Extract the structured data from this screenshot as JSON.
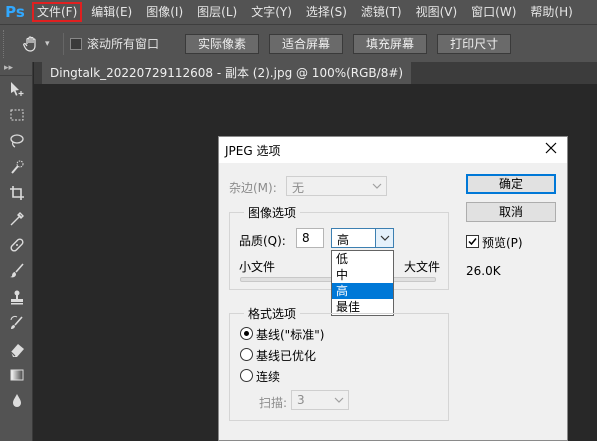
{
  "app": {
    "logo": "Ps",
    "menu": [
      "文件(F)",
      "编辑(E)",
      "图像(I)",
      "图层(L)",
      "文字(Y)",
      "选择(S)",
      "滤镜(T)",
      "视图(V)",
      "窗口(W)",
      "帮助(H)"
    ],
    "highlighted_menu": "文件(F)"
  },
  "options_bar": {
    "scroll_all_label": "滚动所有窗口",
    "buttons": [
      "实际像素",
      "适合屏幕",
      "填充屏幕",
      "打印尺寸"
    ]
  },
  "toolbar": {
    "header": "▸▸",
    "tools": [
      "move-tool",
      "marquee-tool",
      "lasso-tool",
      "quick-selection-tool",
      "crop-tool",
      "eyedropper-tool",
      "healing-brush-tool",
      "brush-tool",
      "clone-stamp-tool",
      "history-brush-tool",
      "eraser-tool",
      "gradient-tool",
      "blur-tool"
    ]
  },
  "document": {
    "tab_title": "Dingtalk_20220729112608 - 副本 (2).jpg @ 100%(RGB/8#)"
  },
  "dialog": {
    "title": "JPEG 选项",
    "matte_label": "杂边(M):",
    "matte_value": "无",
    "image_options_title": "图像选项",
    "quality_label": "品质(Q):",
    "quality_value": "8",
    "quality_level": "高",
    "quality_options": [
      "低",
      "中",
      "高",
      "最佳"
    ],
    "selected_quality_option": "高",
    "small_file_label": "小文件",
    "large_file_label": "大文件",
    "format_options_title": "格式选项",
    "format_options": [
      "基线(\"标准\")",
      "基线已优化",
      "连续"
    ],
    "selected_format": "基线(\"标准\")",
    "scans_label": "扫描:",
    "scans_value": "3",
    "ok_label": "确定",
    "cancel_label": "取消",
    "preview_label": "预览(P)",
    "preview_checked": true,
    "file_size": "26.0K"
  },
  "colors": {
    "ui_panel": "#535353",
    "canvas": "#282828",
    "dialog_bg": "#f0f0f0",
    "selection": "#0078d7",
    "menu_highlight": "#e02020",
    "ps_blue": "#31a8ff"
  }
}
